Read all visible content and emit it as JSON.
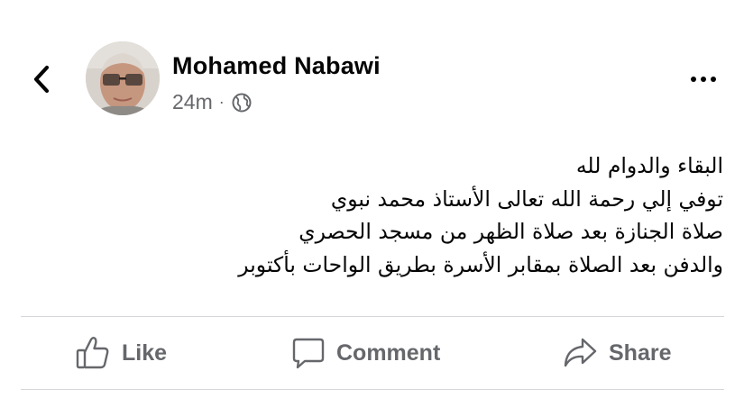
{
  "post": {
    "author": "Mohamed Nabawi",
    "time": "24m",
    "separator": "·",
    "privacy_icon": "globe-icon",
    "lines": [
      "البقاء والدوام لله",
      "توفي إلي رحمة الله تعالى الأستاذ محمد نبوي",
      "صلاة الجنازة بعد صلاة الظهر من مسجد الحصري",
      "والدفن بعد الصلاة بمقابر الأسرة بطريق الواحات بأكتوبر"
    ]
  },
  "actions": {
    "like": "Like",
    "comment": "Comment",
    "share": "Share"
  },
  "colors": {
    "text": "#050505",
    "secondary": "#65676b",
    "divider": "#d6d7da"
  }
}
